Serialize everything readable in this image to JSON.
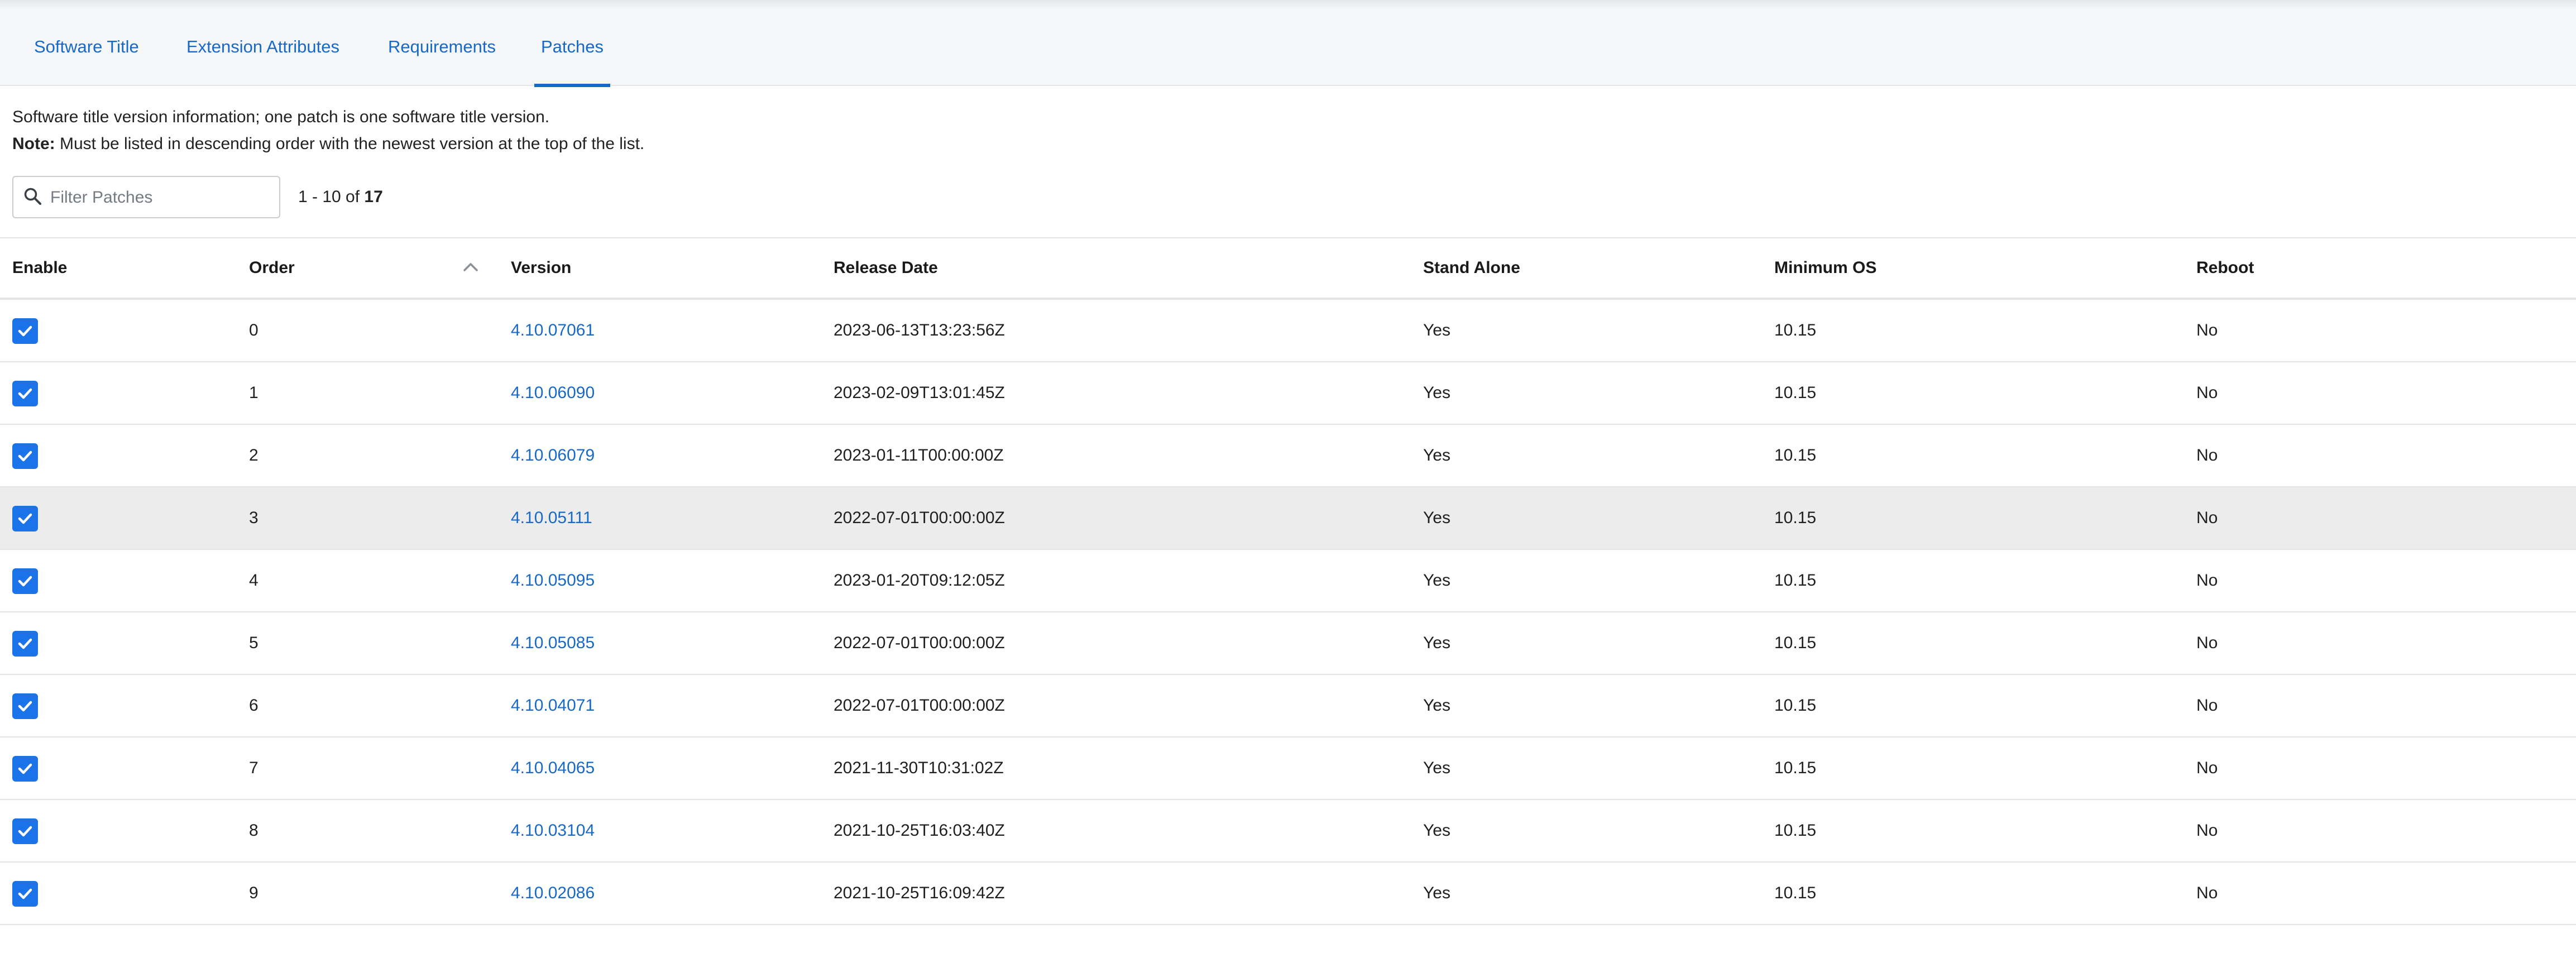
{
  "tabs": [
    {
      "label": "Software Title",
      "active": false
    },
    {
      "label": "Extension Attributes",
      "active": false
    },
    {
      "label": "Requirements",
      "active": false
    },
    {
      "label": "Patches",
      "active": true
    }
  ],
  "description": {
    "line1": "Software title version information; one patch is one software title version.",
    "note_label": "Note:",
    "note_text": " Must be listed in descending order with the newest version at the top of the list."
  },
  "filter": {
    "placeholder": "Filter Patches",
    "value": ""
  },
  "pagination": {
    "range": "1 - 10 of ",
    "total": "17"
  },
  "columns": {
    "enable": "Enable",
    "order": "Order",
    "version": "Version",
    "release_date": "Release Date",
    "stand_alone": "Stand Alone",
    "minimum_os": "Minimum OS",
    "reboot": "Reboot"
  },
  "sort": {
    "column": "order",
    "direction": "ascending"
  },
  "colors": {
    "accent": "#1769c8",
    "checkbox": "#1a73e8",
    "hover_row": "#ececec"
  },
  "rows": [
    {
      "enabled": true,
      "order": "0",
      "version": "4.10.07061",
      "release_date": "2023-06-13T13:23:56Z",
      "stand_alone": "Yes",
      "minimum_os": "10.15",
      "reboot": "No"
    },
    {
      "enabled": true,
      "order": "1",
      "version": "4.10.06090",
      "release_date": "2023-02-09T13:01:45Z",
      "stand_alone": "Yes",
      "minimum_os": "10.15",
      "reboot": "No"
    },
    {
      "enabled": true,
      "order": "2",
      "version": "4.10.06079",
      "release_date": "2023-01-11T00:00:00Z",
      "stand_alone": "Yes",
      "minimum_os": "10.15",
      "reboot": "No"
    },
    {
      "enabled": true,
      "order": "3",
      "version": "4.10.05111",
      "release_date": "2022-07-01T00:00:00Z",
      "stand_alone": "Yes",
      "minimum_os": "10.15",
      "reboot": "No",
      "highlighted": true
    },
    {
      "enabled": true,
      "order": "4",
      "version": "4.10.05095",
      "release_date": "2023-01-20T09:12:05Z",
      "stand_alone": "Yes",
      "minimum_os": "10.15",
      "reboot": "No"
    },
    {
      "enabled": true,
      "order": "5",
      "version": "4.10.05085",
      "release_date": "2022-07-01T00:00:00Z",
      "stand_alone": "Yes",
      "minimum_os": "10.15",
      "reboot": "No"
    },
    {
      "enabled": true,
      "order": "6",
      "version": "4.10.04071",
      "release_date": "2022-07-01T00:00:00Z",
      "stand_alone": "Yes",
      "minimum_os": "10.15",
      "reboot": "No"
    },
    {
      "enabled": true,
      "order": "7",
      "version": "4.10.04065",
      "release_date": "2021-11-30T10:31:02Z",
      "stand_alone": "Yes",
      "minimum_os": "10.15",
      "reboot": "No"
    },
    {
      "enabled": true,
      "order": "8",
      "version": "4.10.03104",
      "release_date": "2021-10-25T16:03:40Z",
      "stand_alone": "Yes",
      "minimum_os": "10.15",
      "reboot": "No"
    },
    {
      "enabled": true,
      "order": "9",
      "version": "4.10.02086",
      "release_date": "2021-10-25T16:09:42Z",
      "stand_alone": "Yes",
      "minimum_os": "10.15",
      "reboot": "No"
    }
  ]
}
